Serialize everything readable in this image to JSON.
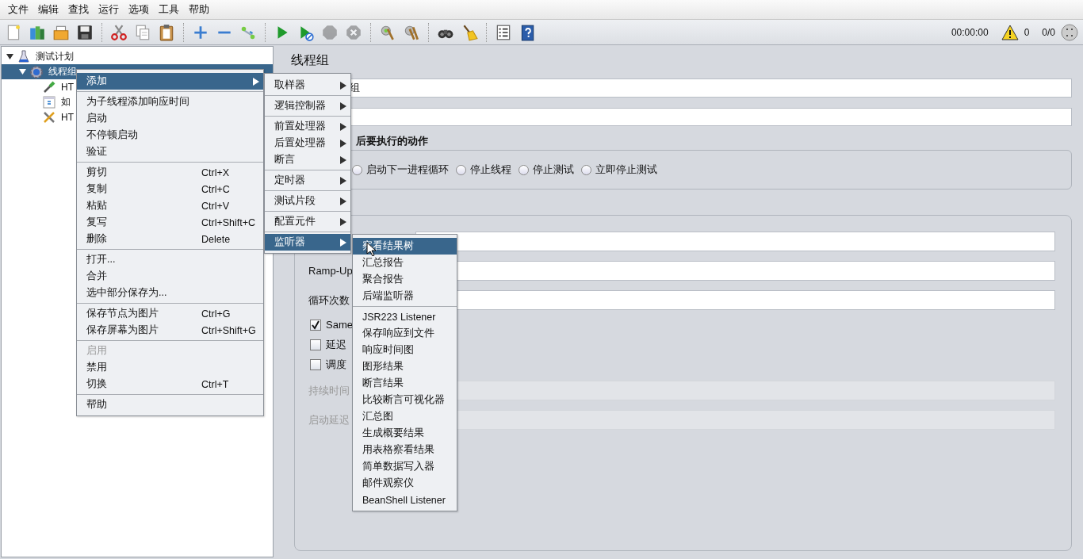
{
  "menu_bar": [
    "文件",
    "编辑",
    "查找",
    "运行",
    "选项",
    "工具",
    "帮助"
  ],
  "toolbar": {
    "groups": [
      [
        {
          "kind": "new",
          "disabled": false
        },
        {
          "kind": "templates",
          "disabled": false
        },
        {
          "kind": "open",
          "disabled": false
        },
        {
          "kind": "save",
          "disabled": false
        }
      ],
      [
        {
          "kind": "cut",
          "disabled": false
        },
        {
          "kind": "copy",
          "disabled": false
        },
        {
          "kind": "paste",
          "disabled": false
        }
      ],
      [
        {
          "kind": "expand",
          "disabled": false
        },
        {
          "kind": "collapse",
          "disabled": false
        },
        {
          "kind": "toggle",
          "disabled": false
        }
      ],
      [
        {
          "kind": "start",
          "disabled": false
        },
        {
          "kind": "start_no_pause",
          "disabled": false
        },
        {
          "kind": "stop",
          "disabled": true
        },
        {
          "kind": "shutdown",
          "disabled": true
        }
      ],
      [
        {
          "kind": "clear",
          "disabled": false
        },
        {
          "kind": "clear_all",
          "disabled": false
        }
      ],
      [
        {
          "kind": "search",
          "disabled": false
        },
        {
          "kind": "reset_search",
          "disabled": false
        }
      ],
      [
        {
          "kind": "function_helper",
          "disabled": false
        },
        {
          "kind": "help",
          "disabled": false
        }
      ]
    ],
    "timer": "00:00:00",
    "warning_count": "0",
    "threads": "0/0"
  },
  "tree": {
    "items": [
      {
        "kind": "plan",
        "label": "测试计划",
        "expanded": true,
        "selected": false,
        "children": [
          {
            "kind": "thread_group",
            "label": "线程组",
            "expanded": true,
            "selected": true,
            "children": [
              {
                "kind": "sampler",
                "label": "HT",
                "selected": false
              },
              {
                "kind": "controller",
                "label": "如",
                "selected": false
              },
              {
                "kind": "config",
                "label": "HT",
                "selected": false
              }
            ]
          }
        ]
      }
    ]
  },
  "thread_group": {
    "title": "线程组",
    "name_value": "组",
    "error_action": {
      "heading": "后要执行的动作",
      "options": [
        {
          "label": "启动下一进程循环",
          "selected": false
        },
        {
          "label": "停止线程",
          "selected": false
        },
        {
          "label": "停止测试",
          "selected": false
        },
        {
          "label": "立即停止测试",
          "selected": false
        }
      ]
    },
    "rows": [
      {
        "kind": "field",
        "disabled": false
      },
      {
        "kind": "field",
        "label": "Ramp-Up",
        "disabled": false
      },
      {
        "kind": "field",
        "label": "循环次数",
        "disabled": false
      },
      {
        "kind": "checkbox",
        "label": "Same",
        "checked": true
      },
      {
        "kind": "checkbox",
        "label": "延迟",
        "checked": false
      },
      {
        "kind": "checkbox",
        "label": "调度",
        "checked": false
      },
      {
        "kind": "field",
        "label": "持续时间",
        "disabled": true
      },
      {
        "kind": "field",
        "label": "启动延迟",
        "disabled": true
      }
    ]
  },
  "context_menu": {
    "groups": [
      [
        {
          "kind": "submenu",
          "label": "添加",
          "selected": true,
          "disabled": false
        }
      ],
      [
        {
          "kind": "item",
          "label": "为子线程添加响应时间",
          "selected": false,
          "disabled": false
        },
        {
          "kind": "item",
          "label": "启动",
          "selected": false,
          "disabled": false
        },
        {
          "kind": "item",
          "label": "不停顿启动",
          "selected": false,
          "disabled": false
        },
        {
          "kind": "item",
          "label": "验证",
          "selected": false,
          "disabled": false
        }
      ],
      [
        {
          "kind": "item",
          "label": "剪切",
          "shortcut": "Ctrl+X",
          "selected": false,
          "disabled": false
        },
        {
          "kind": "item",
          "label": "复制",
          "shortcut": "Ctrl+C",
          "selected": false,
          "disabled": false
        },
        {
          "kind": "item",
          "label": "粘贴",
          "shortcut": "Ctrl+V",
          "selected": false,
          "disabled": false
        },
        {
          "kind": "item",
          "label": "复写",
          "shortcut": "Ctrl+Shift+C",
          "selected": false,
          "disabled": false
        },
        {
          "kind": "item",
          "label": "删除",
          "shortcut": "Delete",
          "selected": false,
          "disabled": false
        }
      ],
      [
        {
          "kind": "item",
          "label": "打开...",
          "selected": false,
          "disabled": false
        },
        {
          "kind": "item",
          "label": "合并",
          "selected": false,
          "disabled": false
        },
        {
          "kind": "item",
          "label": "选中部分保存为...",
          "selected": false,
          "disabled": false
        }
      ],
      [
        {
          "kind": "item",
          "label": "保存节点为图片",
          "shortcut": "Ctrl+G",
          "selected": false,
          "disabled": false
        },
        {
          "kind": "item",
          "label": "保存屏幕为图片",
          "shortcut": "Ctrl+Shift+G",
          "selected": false,
          "disabled": false
        }
      ],
      [
        {
          "kind": "item",
          "label": "启用",
          "selected": false,
          "disabled": true
        },
        {
          "kind": "item",
          "label": "禁用",
          "selected": false,
          "disabled": false
        },
        {
          "kind": "item",
          "label": "切换",
          "shortcut": "Ctrl+T",
          "selected": false,
          "disabled": false
        }
      ],
      [
        {
          "kind": "item",
          "label": "帮助",
          "selected": false,
          "disabled": false
        }
      ]
    ]
  },
  "add_submenu": {
    "groups": [
      [
        {
          "kind": "submenu",
          "label": "取样器",
          "selected": false
        }
      ],
      [
        {
          "kind": "submenu",
          "label": "逻辑控制器",
          "selected": false
        }
      ],
      [
        {
          "kind": "submenu",
          "label": "前置处理器",
          "selected": false
        },
        {
          "kind": "submenu",
          "label": "后置处理器",
          "selected": false
        },
        {
          "kind": "submenu",
          "label": "断言",
          "selected": false
        }
      ],
      [
        {
          "kind": "submenu",
          "label": "定时器",
          "selected": false
        }
      ],
      [
        {
          "kind": "submenu",
          "label": "测试片段",
          "selected": false
        }
      ],
      [
        {
          "kind": "submenu",
          "label": "配置元件",
          "selected": false
        }
      ],
      [
        {
          "kind": "submenu",
          "label": "监听器",
          "selected": true
        }
      ]
    ]
  },
  "listener_submenu": {
    "groups": [
      [
        {
          "kind": "item",
          "label": "察看结果树",
          "selected": true
        },
        {
          "kind": "item",
          "label": "汇总报告",
          "selected": false
        },
        {
          "kind": "item",
          "label": "聚合报告",
          "selected": false
        },
        {
          "kind": "item",
          "label": "后端监听器",
          "selected": false
        }
      ],
      [
        {
          "kind": "item",
          "label": "JSR223 Listener",
          "selected": false
        },
        {
          "kind": "item",
          "label": "保存响应到文件",
          "selected": false
        },
        {
          "kind": "item",
          "label": "响应时间图",
          "selected": false
        },
        {
          "kind": "item",
          "label": "图形结果",
          "selected": false
        },
        {
          "kind": "item",
          "label": "断言结果",
          "selected": false
        },
        {
          "kind": "item",
          "label": "比较断言可视化器",
          "selected": false
        },
        {
          "kind": "item",
          "label": "汇总图",
          "selected": false
        },
        {
          "kind": "item",
          "label": "生成概要结果",
          "selected": false
        },
        {
          "kind": "item",
          "label": "用表格察看结果",
          "selected": false
        },
        {
          "kind": "item",
          "label": "简单数据写入器",
          "selected": false
        },
        {
          "kind": "item",
          "label": "邮件观察仪",
          "selected": false
        },
        {
          "kind": "item",
          "label": "BeanShell Listener",
          "selected": false
        }
      ]
    ]
  }
}
